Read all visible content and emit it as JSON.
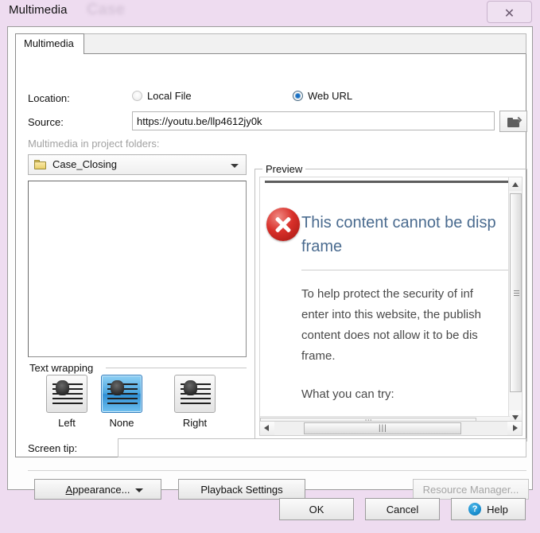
{
  "window": {
    "title": "Multimedia",
    "watermark": "Case",
    "close_label": "✕"
  },
  "tabs": [
    {
      "label": "Multimedia",
      "active": true
    }
  ],
  "form": {
    "location_label": "Location:",
    "radio_local_label": "Local File",
    "radio_web_label": "Web URL",
    "selected_location": "Web URL",
    "source_label": "Source:",
    "source_value": "https://youtu.be/llp4612jy0k",
    "source_placeholder": "",
    "browse_icon": "open-folder-icon",
    "folders_label": "Multimedia in project folders:",
    "folder_selected": "Case_Closing",
    "folder_icon": "folder-icon",
    "folder_chevron": "chevron-down-icon",
    "media_list_items": []
  },
  "text_wrapping": {
    "caption": "Text wrapping",
    "options": [
      {
        "label": "Left",
        "selected": false
      },
      {
        "label": "None",
        "selected": true
      },
      {
        "label": "Right",
        "selected": false
      }
    ]
  },
  "screen_tip": {
    "label": "Screen tip:",
    "value": "",
    "placeholder": ""
  },
  "actions": {
    "appearance_prefix": "A",
    "appearance_suffix": "ppearance...",
    "playback_label": "Playback Settings",
    "resource_label": "Resource Manager...",
    "resource_disabled": true
  },
  "footer": {
    "ok_label": "OK",
    "cancel_label": "Cancel",
    "help_label": "Help",
    "help_icon_glyph": "?"
  },
  "preview": {
    "legend": "Preview",
    "error_icon": "error-x-icon",
    "heading": "This content cannot be disp\nframe",
    "body": "To help protect the security of inf\nenter into this website, the publish\ncontent does not allow it to be dis\nframe.",
    "what_you_can_try": "What you can try:"
  },
  "colors": {
    "window_bg": "#eedcf0",
    "dialog_bg": "#fdfdfd",
    "accent_blue": "#1b6ec2",
    "error_red": "#d8302a",
    "heading_blue": "#4a6b8f",
    "help_blue": "#1a8fd0",
    "folder_yellow": "#e8cf6a"
  }
}
